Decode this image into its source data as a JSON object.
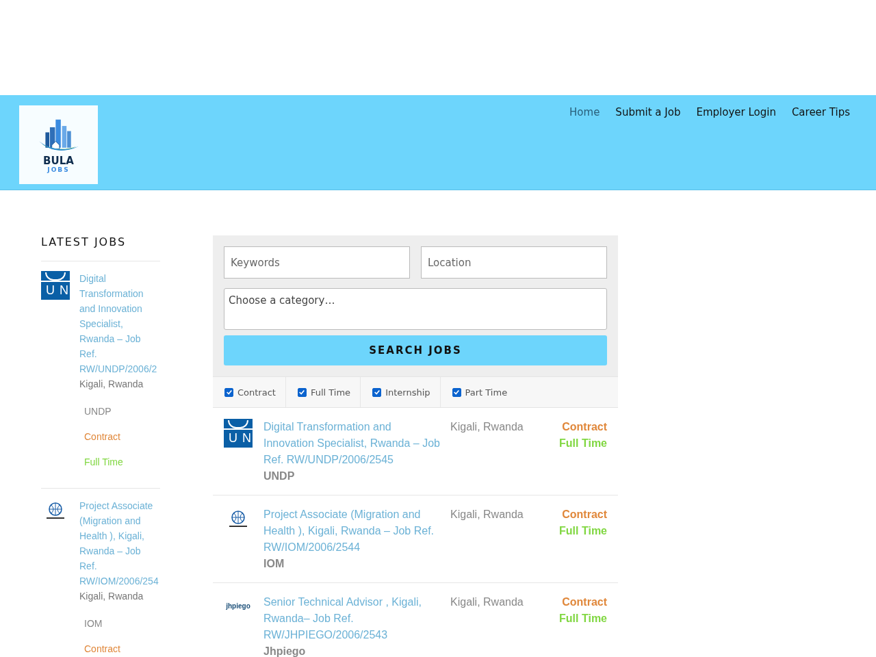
{
  "header": {
    "logo": {
      "name": "BULA",
      "sub": "JOBS"
    },
    "nav": [
      {
        "label": "Home",
        "selected": true
      },
      {
        "label": "Submit a Job",
        "selected": false
      },
      {
        "label": "Employer Login",
        "selected": false
      },
      {
        "label": "Career Tips",
        "selected": false
      }
    ]
  },
  "sidebar": {
    "title": "LATEST JOBS",
    "jobs": [
      {
        "logo": {
          "kind": "un",
          "text": "UN"
        },
        "title": "Digital Transformation and Innovation Specialist, Rwanda – Job Ref. RW/UNDP/2006/2",
        "location": "Kigali, Rwanda",
        "company": "UNDP",
        "types": [
          {
            "label": "Contract",
            "kind": "contract"
          },
          {
            "label": "Full Time",
            "kind": "full-time"
          }
        ]
      },
      {
        "logo": {
          "kind": "iom"
        },
        "title": "Project Associate (Migration and Health ), Kigali, Rwanda – Job Ref. RW/IOM/2006/254",
        "location": "Kigali, Rwanda",
        "company": "IOM",
        "types": [
          {
            "label": "Contract",
            "kind": "contract"
          }
        ]
      }
    ]
  },
  "search": {
    "keywords": {
      "placeholder": "Keywords"
    },
    "location": {
      "placeholder": "Location"
    },
    "category": {
      "placeholder": "Choose a category…"
    },
    "button": "SEARCH JOBS",
    "filters": [
      {
        "label": "Contract",
        "checked": true
      },
      {
        "label": "Full Time",
        "checked": true
      },
      {
        "label": "Internship",
        "checked": true
      },
      {
        "label": "Part Time",
        "checked": true
      }
    ]
  },
  "jobs": [
    {
      "logo": {
        "kind": "un",
        "text": "UN"
      },
      "title": "Digital Transformation and Innovation Specialist, Rwanda – Job Ref. RW/UNDP/2006/2545",
      "company": "UNDP",
      "location": "Kigali, Rwanda",
      "types": [
        {
          "label": "Contract",
          "kind": "contract"
        },
        {
          "label": "Full Time",
          "kind": "full-time"
        }
      ]
    },
    {
      "logo": {
        "kind": "iom"
      },
      "title": "Project Associate (Migration and Health ), Kigali, Rwanda – Job Ref. RW/IOM/2006/2544",
      "company": "IOM",
      "location": "Kigali, Rwanda",
      "types": [
        {
          "label": "Contract",
          "kind": "contract"
        },
        {
          "label": "Full Time",
          "kind": "full-time"
        }
      ]
    },
    {
      "logo": {
        "kind": "jhpiego",
        "text": "jhpiego"
      },
      "title": "Senior Technical Advisor , Kigali, Rwanda– Job Ref. RW/JHPIEGO/2006/2543",
      "company": "Jhpiego",
      "location": "Kigali, Rwanda",
      "types": [
        {
          "label": "Contract",
          "kind": "contract"
        },
        {
          "label": "Full Time",
          "kind": "full-time"
        }
      ]
    }
  ]
}
